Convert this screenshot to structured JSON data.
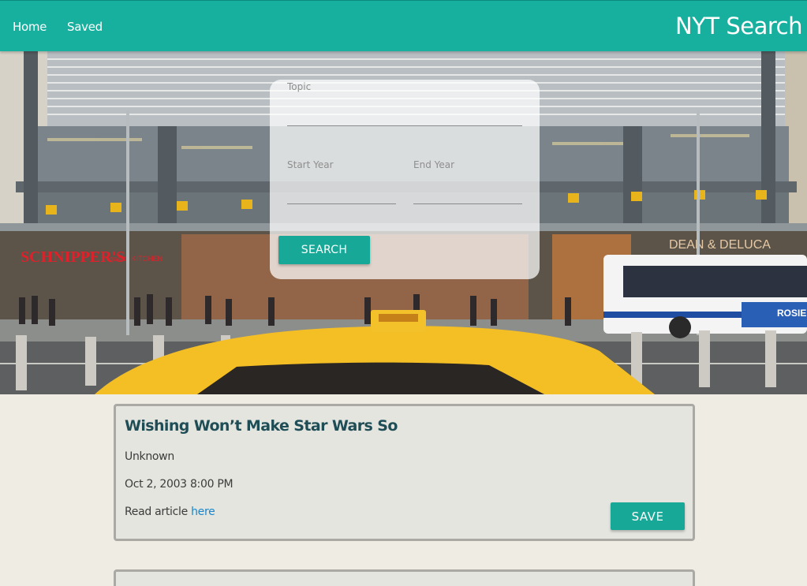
{
  "nav": {
    "home_label": "Home",
    "saved_label": "Saved",
    "brand": "NYT Search"
  },
  "search": {
    "topic_label": "Topic",
    "topic_value": "",
    "start_year_label": "Start Year",
    "start_year_value": "",
    "end_year_label": "End Year",
    "end_year_value": "",
    "button_label": "SEARCH"
  },
  "hero_signs": {
    "left_store": "SCHNIPPER'S",
    "left_store_sub": "quality KITCHEN",
    "right_store": "DEAN & DELUCA",
    "bus_ad": "ROSIE"
  },
  "articles": [
    {
      "title": "Wishing Won’t Make Star Wars So",
      "author": "Unknown",
      "date": "Oct 2, 2003 8:00 PM",
      "read_prefix": "Read article ",
      "link_text": "here",
      "save_label": "SAVE"
    }
  ],
  "colors": {
    "accent": "#17b09f",
    "title": "#1f4d56",
    "link": "#1a86c9"
  }
}
